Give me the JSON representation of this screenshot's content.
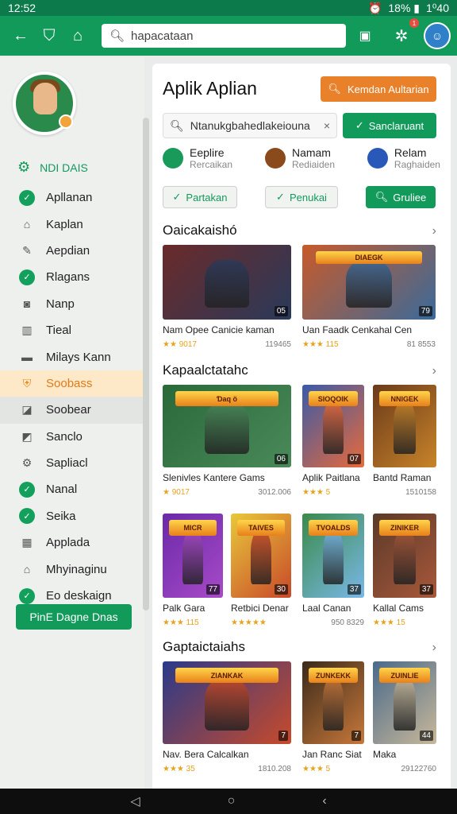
{
  "status": {
    "time": "12:52",
    "right_text": "18% ▮",
    "clock": "1⁰40"
  },
  "topbar": {
    "search_value": "hapacataan",
    "notif_count": "1"
  },
  "sidebar": {
    "header": "NDI DAIS",
    "items": [
      {
        "label": "Apllanan",
        "icon": "check-circle-icon"
      },
      {
        "label": "Kaplan",
        "icon": "home-icon"
      },
      {
        "label": "Aepdian",
        "icon": "pencil-icon"
      },
      {
        "label": "Rlagans",
        "icon": "check-circle-icon"
      },
      {
        "label": "Nanp",
        "icon": "camera-icon"
      },
      {
        "label": "Tieal",
        "icon": "building-icon"
      },
      {
        "label": "Milays Kann",
        "icon": "briefcase-icon"
      },
      {
        "label": "Soobass",
        "icon": "shield-icon"
      },
      {
        "label": "Soobear",
        "icon": "tag-icon"
      },
      {
        "label": "Sanclo",
        "icon": "doc-icon"
      },
      {
        "label": "Sapliacl",
        "icon": "gear-icon"
      },
      {
        "label": "Nanal",
        "icon": "check-circle-icon"
      },
      {
        "label": "Seika",
        "icon": "check-circle-icon"
      },
      {
        "label": "Applada",
        "icon": "calendar-icon"
      },
      {
        "label": "Mhyinaginu",
        "icon": "house-icon"
      },
      {
        "label": "Eo deskaign",
        "icon": "check-circle-icon"
      }
    ],
    "button": "PinE Dagne Dnas"
  },
  "main": {
    "title": "Aplik Aplian",
    "top_button": "Kemdan Aultarian",
    "search_value": "Ntanukgbahedlakeiouna",
    "search_button": "Sanclaruant",
    "categories": [
      {
        "title": "Eeplire",
        "sub": "Rercaikan",
        "color": "#1a9a5a"
      },
      {
        "title": "Namam",
        "sub": "Rediaiden",
        "color": "#8a4a1c"
      },
      {
        "title": "Relam",
        "sub": "Raghaiden",
        "color": "#2a58b8"
      }
    ],
    "chips": [
      "Partakan",
      "Penukai",
      "Gruliee"
    ],
    "sections": [
      {
        "title": "Oaicakaishó"
      },
      {
        "title": "Kapaalctatahc"
      },
      {
        "title": "Gaptaictaiahs"
      }
    ],
    "cards": [
      {
        "name": "Nam Opee Canicie kaman",
        "rating": "★★ 9017",
        "count": "119465",
        "num": "05"
      },
      {
        "name": "Uan Faadk Cenkahal Cen",
        "rating": "★★★ 115",
        "count": "81 8553",
        "num": "79"
      },
      {
        "name": "Slenivles Kantere Gams",
        "rating": "★ 9017",
        "count": "3012.006",
        "num": "06"
      },
      {
        "name": "Aplik Paitlana",
        "rating": "★★★ 5",
        "count": "",
        "num": "07"
      },
      {
        "name": "Bantd Raman",
        "rating": "",
        "count": "1510158",
        "num": ""
      },
      {
        "name": "Palk Gara",
        "rating": "★★★ 115",
        "count": "",
        "num": "77"
      },
      {
        "name": "Retbici Denar",
        "rating": "★★★★★",
        "count": "",
        "num": "30"
      },
      {
        "name": "Laal Canan",
        "rating": "",
        "count": "950 8329",
        "num": "37"
      },
      {
        "name": "Kallal Cams",
        "rating": "★★★ 15",
        "count": "",
        "num": "37"
      },
      {
        "name": "Nav. Bera Calcalkan",
        "rating": "★★★ 35",
        "count": "1810.208",
        "num": "7"
      },
      {
        "name": "Jan Ranc Siat",
        "rating": "★★★ 5",
        "count": "",
        "num": "7"
      },
      {
        "name": "Maka",
        "rating": "",
        "count": "29122760",
        "num": "44"
      }
    ],
    "banners": [
      "",
      "DIAEGK",
      "Ɗaq ö",
      "SIOQOIK",
      "NNIGEK",
      "MICR",
      "TAIVES",
      "TVOALDS",
      "ZINIKER",
      "ZIANKAK",
      "ZUNKEKK",
      "ZUINLIE"
    ]
  }
}
